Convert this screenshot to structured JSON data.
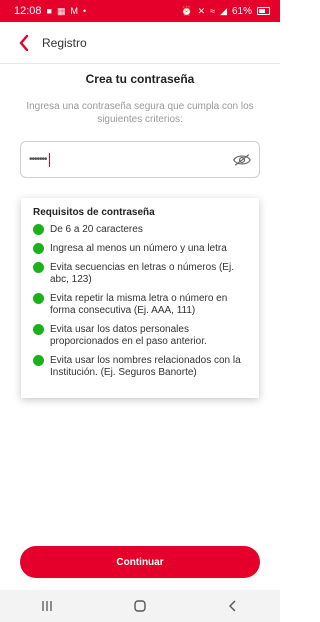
{
  "status_bar": {
    "time": "12:08",
    "battery": "61%",
    "left_icons": [
      "messages-icon",
      "gallery-icon",
      "gmail-icon",
      "dot-icon"
    ],
    "right_icons": [
      "alarm-icon",
      "mute-icon",
      "wifi-icon",
      "signal-icon",
      "battery-icon"
    ]
  },
  "header": {
    "title": "Registro"
  },
  "main": {
    "heading": "Crea tu contraseña",
    "subtitle": "Ingresa una contraseña segura que cumpla con los siguientes criterios:",
    "password_value": "•••••••"
  },
  "requirements": {
    "title": "Requisitos de contraseña",
    "items": [
      "De 6 a 20 caracteres",
      "Ingresa al menos un número y una letra",
      "Evita secuencias en letras o números (Ej. abc, 123)",
      "Evita repetir la misma letra o número en forma consecutiva (Ej. AAA, 111)",
      "Evita usar los datos personales proporcionados en el paso anterior.",
      "Evita usar los nombres relacionados con la Institución. (Ej. Seguros Banorte)"
    ]
  },
  "actions": {
    "continue_label": "Continuar"
  },
  "colors": {
    "brand_red": "#e5002b",
    "check_green": "#1ab21a"
  }
}
